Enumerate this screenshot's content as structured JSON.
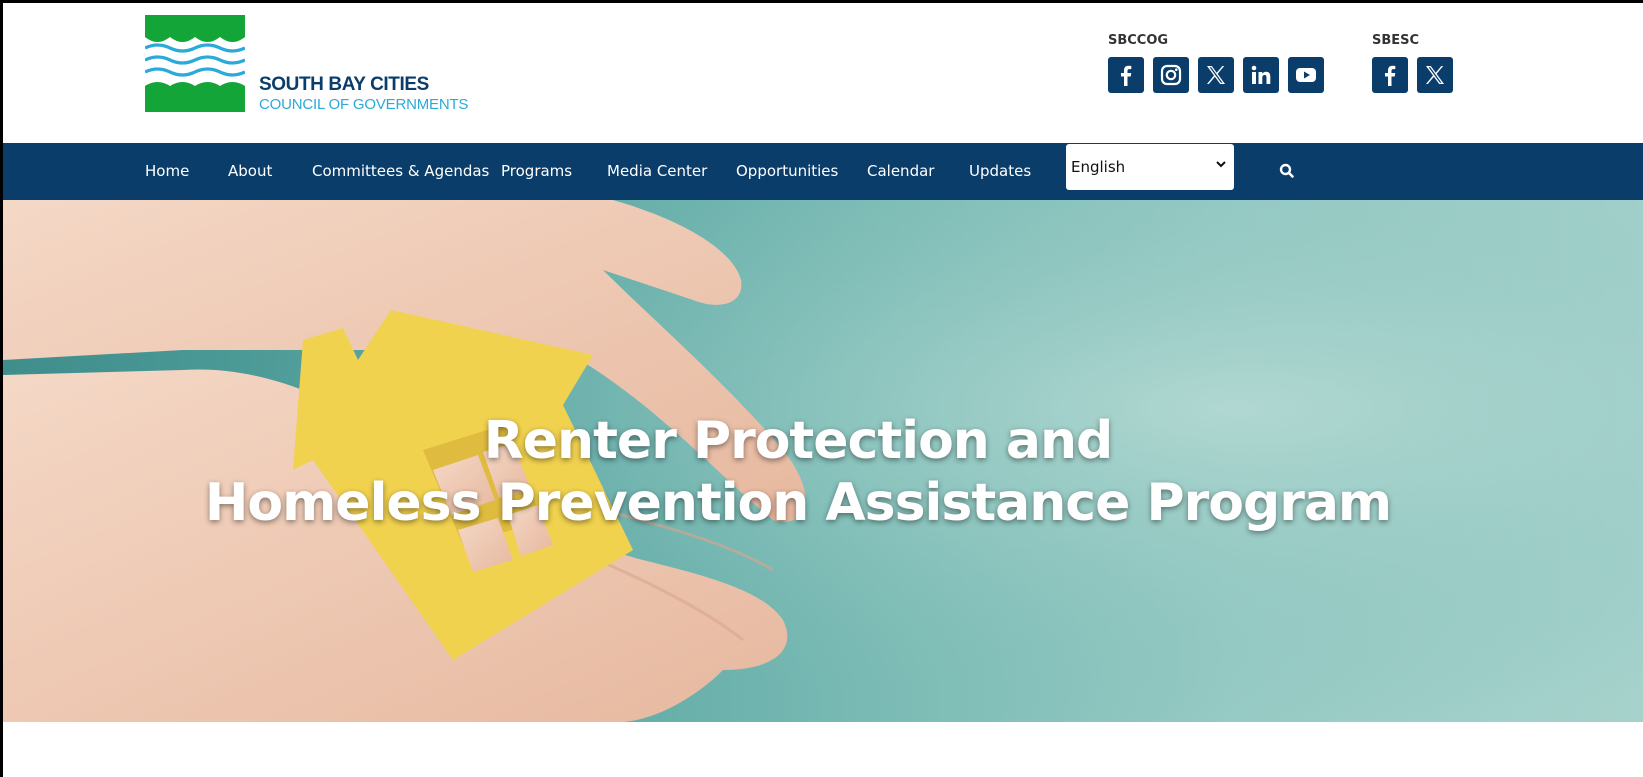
{
  "logo": {
    "line1": "SOUTH BAY CITIES",
    "line2": "COUNCIL OF GOVERNMENTS",
    "colors": {
      "green": "#13a538",
      "blue": "#2aaad9",
      "navy": "#0b3d6b"
    }
  },
  "social": {
    "sbccog": {
      "label": "SBCCOG",
      "icons": [
        "facebook-icon",
        "instagram-icon",
        "x-icon",
        "linkedin-icon",
        "youtube-icon"
      ]
    },
    "sbesc": {
      "label": "SBESC",
      "icons": [
        "facebook-icon",
        "x-icon"
      ]
    }
  },
  "nav": {
    "items": [
      {
        "label": "Home"
      },
      {
        "label": "About"
      },
      {
        "label": "Committees & Agendas"
      },
      {
        "label": "Programs"
      },
      {
        "label": "Media Center"
      },
      {
        "label": "Opportunities"
      },
      {
        "label": "Calendar"
      },
      {
        "label": "Updates"
      }
    ],
    "language": {
      "selected": "English"
    },
    "search_icon": "search-icon"
  },
  "hero": {
    "title_line1": "Renter Protection and",
    "title_line2": "Homeless Prevention Assistance Program"
  },
  "colors": {
    "nav_bg": "#0b3d6b",
    "hero_teal": "#7dbcb6",
    "house_yellow": "#f1d24f"
  }
}
